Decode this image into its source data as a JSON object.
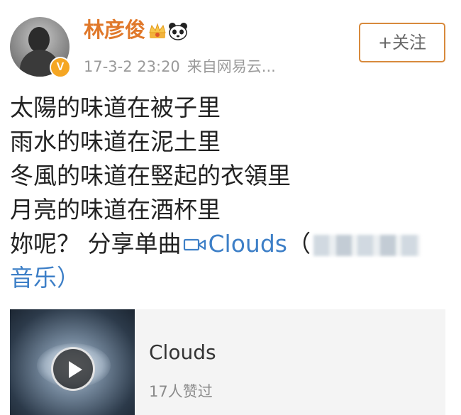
{
  "post": {
    "username": "林彦俊",
    "time": "17-3-2 23:20",
    "source": "来自网易云...",
    "follow_label": "+关注",
    "verified_label": "V",
    "content_lines": [
      "太陽的味道在被子里",
      "雨水的味道在泥土里",
      "冬風的味道在竪起的衣領里",
      "月亮的味道在酒杯里"
    ],
    "share_prefix": "妳呢？ 分享单曲",
    "share_link_label": "Clouds",
    "share_source_open": "（",
    "share_source_tail": "音乐）"
  },
  "music_card": {
    "title": "Clouds",
    "likes": "17人赞过"
  },
  "icons": {
    "crown": "crown-icon",
    "panda": "panda-icon",
    "link": "music-link-icon",
    "play": "play-icon",
    "verified": "verified-badge-icon"
  },
  "colors": {
    "username": "#e0782a",
    "link": "#3d7fc7",
    "meta": "#9a9a9a",
    "follow_border": "#d88a3c",
    "card_bg": "#f4f4f4"
  }
}
